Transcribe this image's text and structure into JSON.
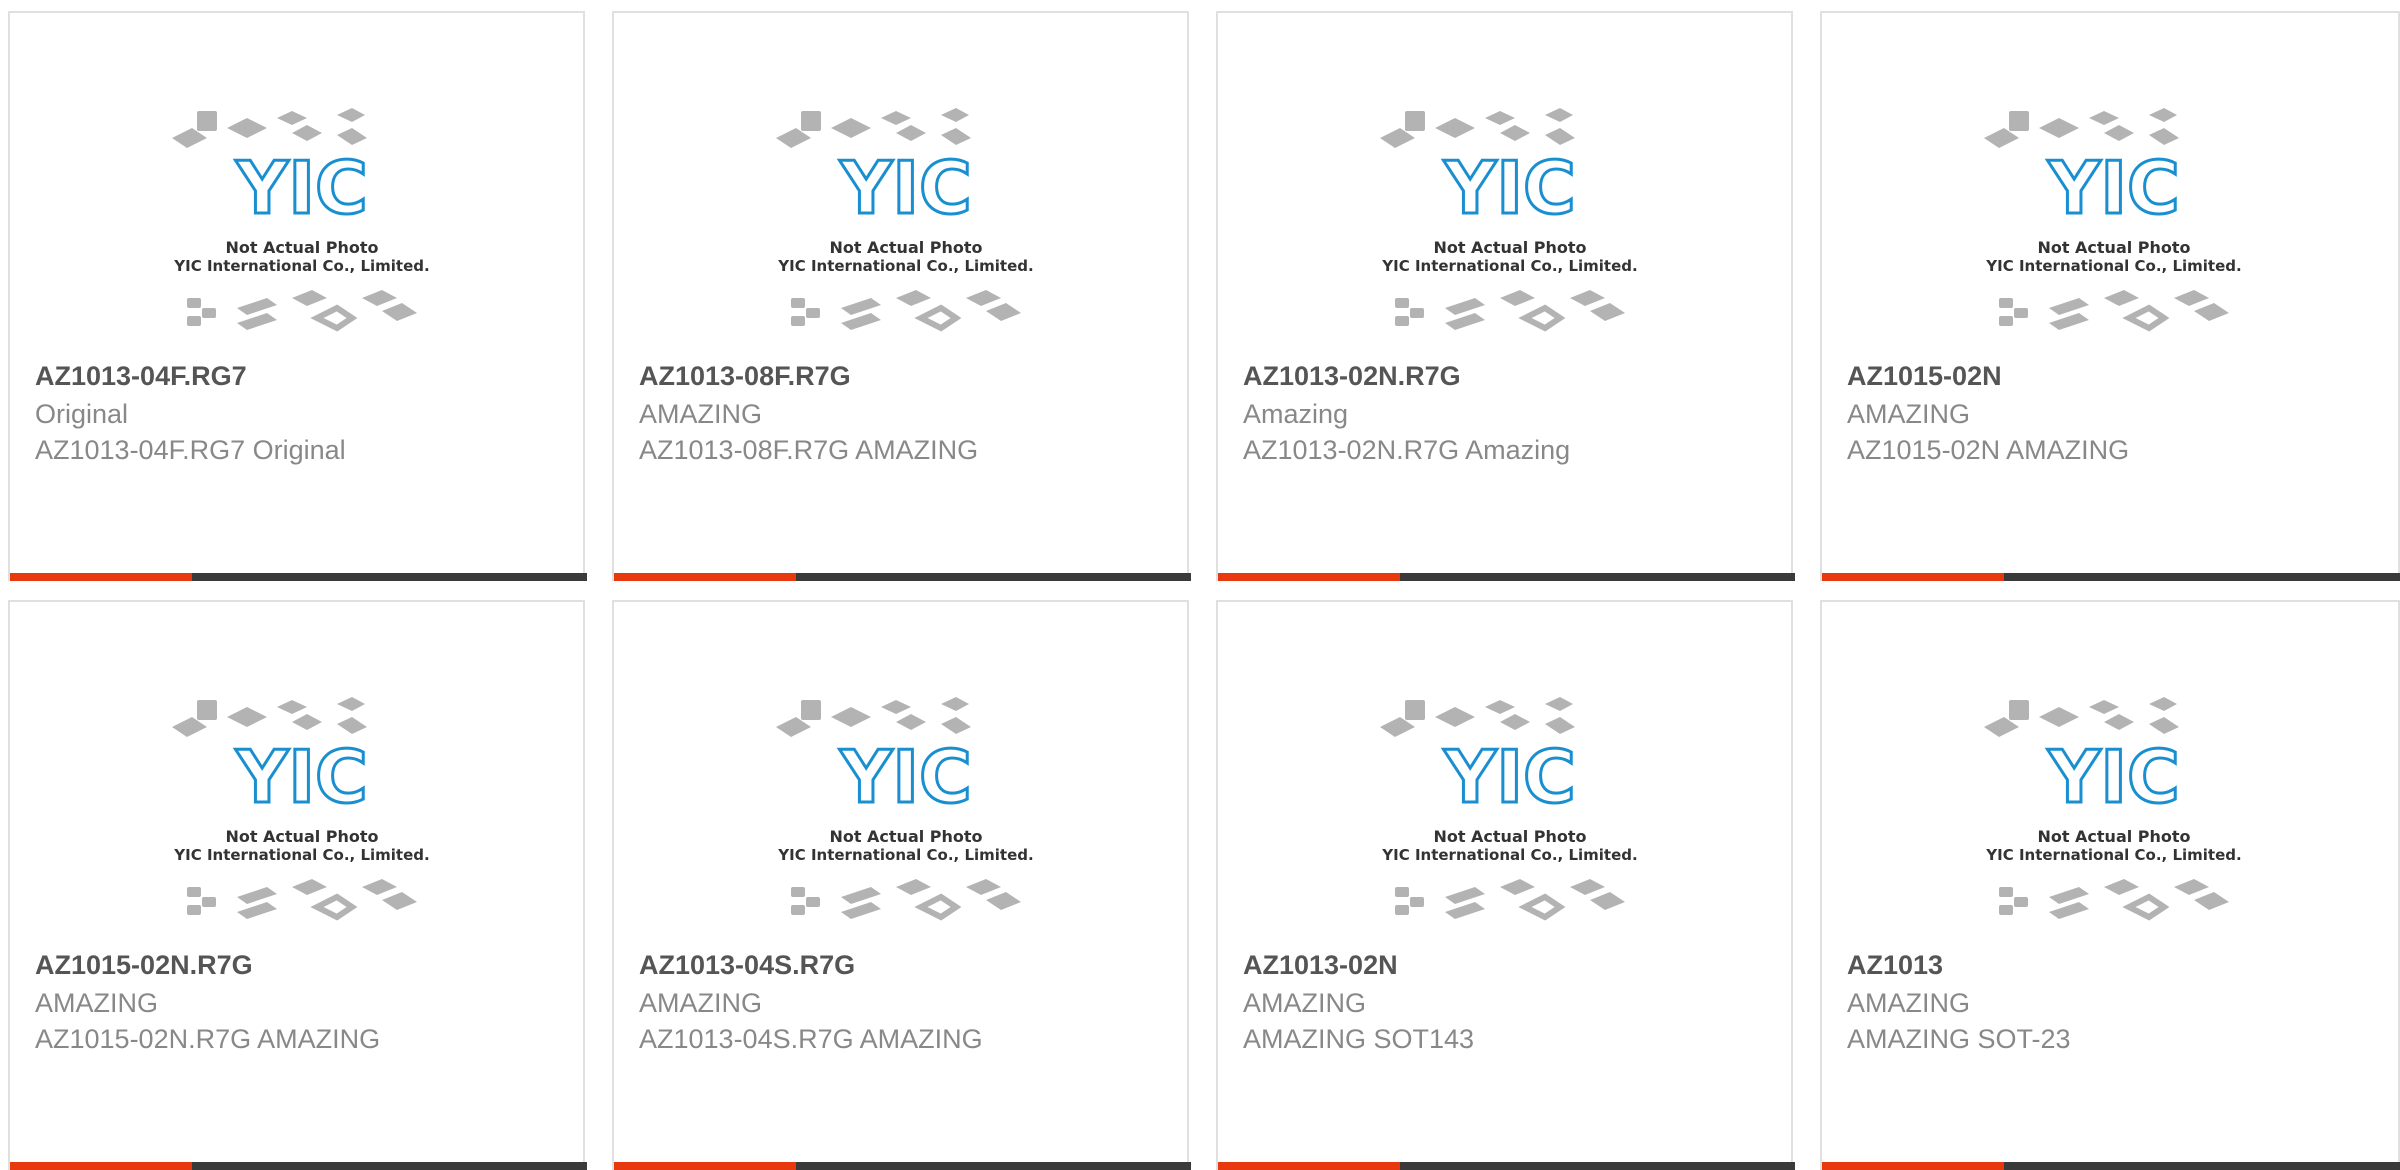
{
  "placeholder": {
    "line1": "Not Actual Photo",
    "line2": "YIC International Co., Limited.",
    "logo_text": "YIC"
  },
  "colors": {
    "accent": "#e8380d",
    "bar": "#3a3a3a",
    "logo": "#1a8fd0",
    "border": "#e0e0e0"
  },
  "products": [
    {
      "part": "AZ1013-04F.RG7",
      "brand": "Original",
      "desc": "AZ1013-04F.RG7 Original"
    },
    {
      "part": "AZ1013-08F.R7G",
      "brand": "AMAZING",
      "desc": "AZ1013-08F.R7G AMAZING"
    },
    {
      "part": "AZ1013-02N.R7G",
      "brand": "Amazing",
      "desc": "AZ1013-02N.R7G Amazing"
    },
    {
      "part": "AZ1015-02N",
      "brand": "AMAZING",
      "desc": "AZ1015-02N AMAZING"
    },
    {
      "part": "AZ1015-02N.R7G",
      "brand": "AMAZING",
      "desc": "AZ1015-02N.R7G AMAZING"
    },
    {
      "part": "AZ1013-04S.R7G",
      "brand": "AMAZING",
      "desc": "AZ1013-04S.R7G AMAZING"
    },
    {
      "part": "AZ1013-02N",
      "brand": "AMAZING",
      "desc": "AMAZING SOT143"
    },
    {
      "part": "AZ1013",
      "brand": "AMAZING",
      "desc": "AMAZING SOT-23"
    }
  ]
}
